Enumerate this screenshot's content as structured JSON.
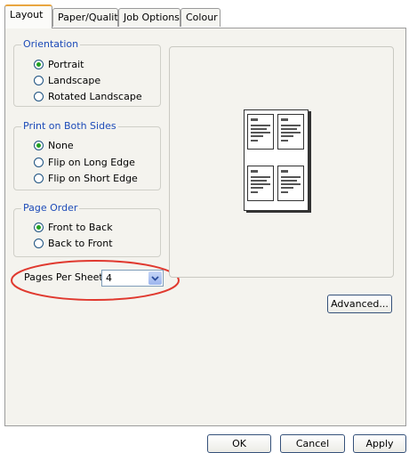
{
  "tabs": [
    "Layout",
    "Paper/Quality",
    "Job Options",
    "Colour"
  ],
  "orientation": {
    "title": "Orientation",
    "options": [
      "Portrait",
      "Landscape",
      "Rotated Landscape"
    ],
    "selected": "Portrait"
  },
  "duplex": {
    "title": "Print on Both Sides",
    "options": [
      "None",
      "Flip on Long Edge",
      "Flip on Short Edge"
    ],
    "selected": "None"
  },
  "page_order": {
    "title": "Page Order",
    "options": [
      "Front to Back",
      "Back to Front"
    ],
    "selected": "Front to Back"
  },
  "pages_per_sheet": {
    "label": "Pages Per Sheet:",
    "value": "4"
  },
  "buttons": {
    "advanced": "Advanced...",
    "ok": "OK",
    "cancel": "Cancel",
    "apply": "Apply"
  },
  "colors": {
    "highlight_circle": "#e0392f",
    "group_title": "#1d4bb8"
  }
}
